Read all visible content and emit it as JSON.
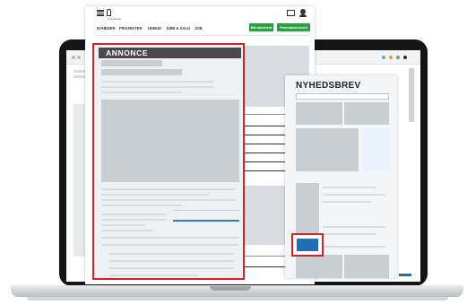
{
  "site": {
    "logo_text": "Licitationen",
    "nav": [
      "NYHEDER",
      "PROJEKTER",
      "UDBUD",
      "KØB & SALG",
      "JOB"
    ],
    "buttons": [
      "Bliv abonnent",
      "Prøveabonnement"
    ]
  },
  "ad": {
    "header": "ANNONCE"
  },
  "newsletter": {
    "title": "NYHEDSBREV"
  },
  "colors": {
    "highlight": "#d62027",
    "brand_green": "#2e9e46",
    "cta_blue": "#1f6fb2",
    "laptop": "#151515"
  }
}
